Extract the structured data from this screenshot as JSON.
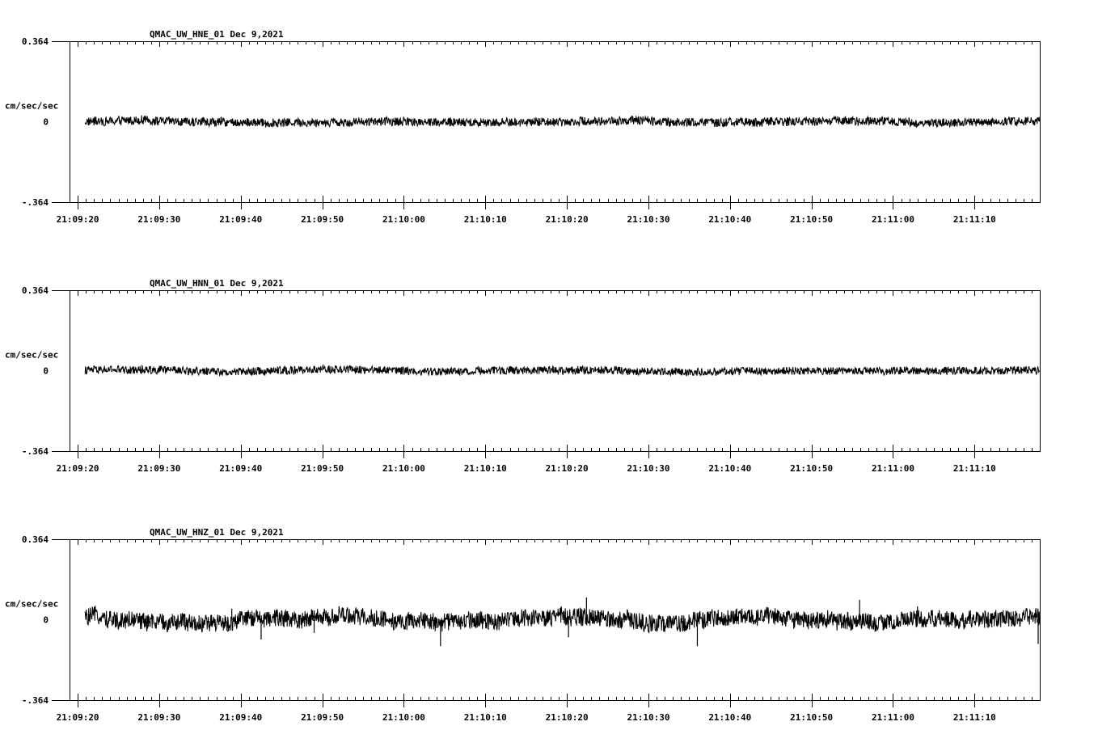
{
  "chart_data": [
    {
      "type": "line",
      "title": "QMAC_UW_HNE_01   Dec 9,2021",
      "ylabel": "cm/sec/sec",
      "ylim": [
        -0.364,
        0.364
      ],
      "ytick_labels": [
        "0.364",
        "0",
        "-.364"
      ],
      "xlim_seconds": [
        19,
        138
      ],
      "x_tick_labels": [
        "21:09:20",
        "21:09:30",
        "21:09:40",
        "21:09:50",
        "21:10:00",
        "21:10:10",
        "21:10:20",
        "21:10:30",
        "21:10:40",
        "21:10:50",
        "21:11:00",
        "21:11:10"
      ],
      "series": [
        {
          "amplitude": 0.02,
          "wander": 0.006,
          "spikes": []
        }
      ]
    },
    {
      "type": "line",
      "title": "QMAC_UW_HNN_01   Dec 9,2021",
      "ylabel": "cm/sec/sec",
      "ylim": [
        -0.364,
        0.364
      ],
      "ytick_labels": [
        "0.364",
        "0",
        "-.364"
      ],
      "xlim_seconds": [
        19,
        138
      ],
      "x_tick_labels": [
        "21:09:20",
        "21:09:30",
        "21:09:40",
        "21:09:50",
        "21:10:00",
        "21:10:10",
        "21:10:20",
        "21:10:30",
        "21:10:40",
        "21:10:50",
        "21:11:00",
        "21:11:10"
      ],
      "series": [
        {
          "amplitude": 0.018,
          "wander": 0.005,
          "spikes": []
        }
      ]
    },
    {
      "type": "line",
      "title": "QMAC_UW_HNZ_01   Dec 9,2021",
      "ylabel": "cm/sec/sec",
      "ylim": [
        -0.364,
        0.364
      ],
      "ytick_labels": [
        "0.364",
        "0",
        "-.364"
      ],
      "xlim_seconds": [
        19,
        138
      ],
      "x_tick_labels": [
        "21:09:20",
        "21:09:30",
        "21:09:40",
        "21:09:50",
        "21:10:00",
        "21:10:10",
        "21:10:20",
        "21:10:30",
        "21:10:40",
        "21:10:50",
        "21:11:00",
        "21:11:10"
      ],
      "series": [
        {
          "amplitude": 0.04,
          "wander": 0.02,
          "spikes": [
            {
              "t": 38.9,
              "v": 0.05
            },
            {
              "t": 42.5,
              "v": -0.09
            },
            {
              "t": 49.0,
              "v": -0.06
            },
            {
              "t": 64.5,
              "v": -0.12
            },
            {
              "t": 80.2,
              "v": -0.08
            },
            {
              "t": 82.4,
              "v": 0.1
            },
            {
              "t": 96.0,
              "v": -0.12
            },
            {
              "t": 115.9,
              "v": 0.09
            },
            {
              "t": 123.0,
              "v": 0.06
            },
            {
              "t": 137.8,
              "v": -0.11
            }
          ]
        }
      ]
    }
  ]
}
